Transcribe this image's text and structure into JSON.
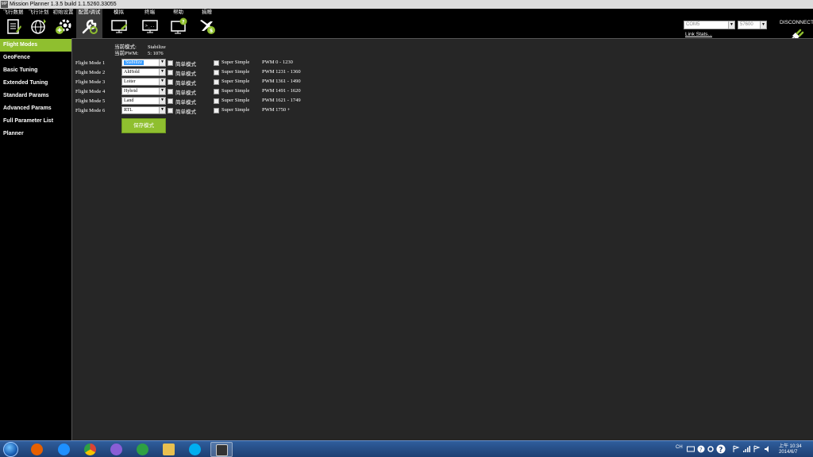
{
  "window": {
    "title": "Mission Planner 1.3.5 build 1.1.5260.33055",
    "icon_text": "MP"
  },
  "menu": [
    {
      "label": "飞行数据",
      "icon": "flight-data-icon"
    },
    {
      "label": "飞行计划",
      "icon": "flight-plan-icon"
    },
    {
      "label": "初始设置",
      "icon": "initial-setup-icon"
    },
    {
      "label": "配置/调试",
      "icon": "config-tuning-icon",
      "active": true
    },
    {
      "label": "模拟",
      "icon": "simulation-icon"
    },
    {
      "label": "终端",
      "icon": "terminal-icon"
    },
    {
      "label": "帮助",
      "icon": "help-icon"
    },
    {
      "label": "捐赠",
      "icon": "donate-icon"
    }
  ],
  "connection": {
    "port": "COM5",
    "baud": "57600",
    "link_stats": "Link Stats...",
    "disconnect": "DISCONNECT"
  },
  "sidebar": {
    "items": [
      {
        "label": "Flight Modes",
        "active": true
      },
      {
        "label": "GeoFence"
      },
      {
        "label": "Basic Tuning"
      },
      {
        "label": "Extended Tuning"
      },
      {
        "label": "Standard Params"
      },
      {
        "label": "Advanced Params"
      },
      {
        "label": "Full Parameter List"
      },
      {
        "label": "Planner"
      }
    ]
  },
  "flight_modes": {
    "current_mode_label": "当前模式:",
    "current_mode_value": "Stabilize",
    "current_pwm_label": "当前PWM:",
    "current_pwm_value": "5: 1076",
    "simple_label": "简单模式",
    "super_simple_label": "Super Simple",
    "save_button": "保存模式",
    "rows": [
      {
        "name": "Flight Mode 1",
        "mode": "Stabilize",
        "pwm": "PWM 0 - 1230",
        "focused": true
      },
      {
        "name": "Flight Mode 2",
        "mode": "AltHold",
        "pwm": "PWM 1231 - 1360"
      },
      {
        "name": "Flight Mode 3",
        "mode": "Loiter",
        "pwm": "PWM 1361 - 1490"
      },
      {
        "name": "Flight Mode 4",
        "mode": "Hybrid",
        "pwm": "PWM 1491 - 1620"
      },
      {
        "name": "Flight Mode 5",
        "mode": "Land",
        "pwm": "PWM 1621 - 1749"
      },
      {
        "name": "Flight Mode 6",
        "mode": "RTL",
        "pwm": "PWM 1750 +"
      }
    ]
  },
  "taskbar": {
    "apps": [
      {
        "name": "firefox-icon",
        "color": "#e66000"
      },
      {
        "name": "internet-explorer-icon",
        "color": "#1e90ff"
      },
      {
        "name": "chrome-icon",
        "color": "#dd4433"
      },
      {
        "name": "qq-icon",
        "color": "#8a5ed6"
      },
      {
        "name": "360-browser-icon",
        "color": "#2ea043"
      },
      {
        "name": "file-explorer-icon",
        "color": "#e8c050"
      },
      {
        "name": "skype-icon",
        "color": "#00aff0"
      },
      {
        "name": "mission-planner-icon",
        "color": "#333333",
        "active": true
      }
    ],
    "lang": "CH",
    "time": "上午 10:34",
    "date": "2014/6/7"
  }
}
